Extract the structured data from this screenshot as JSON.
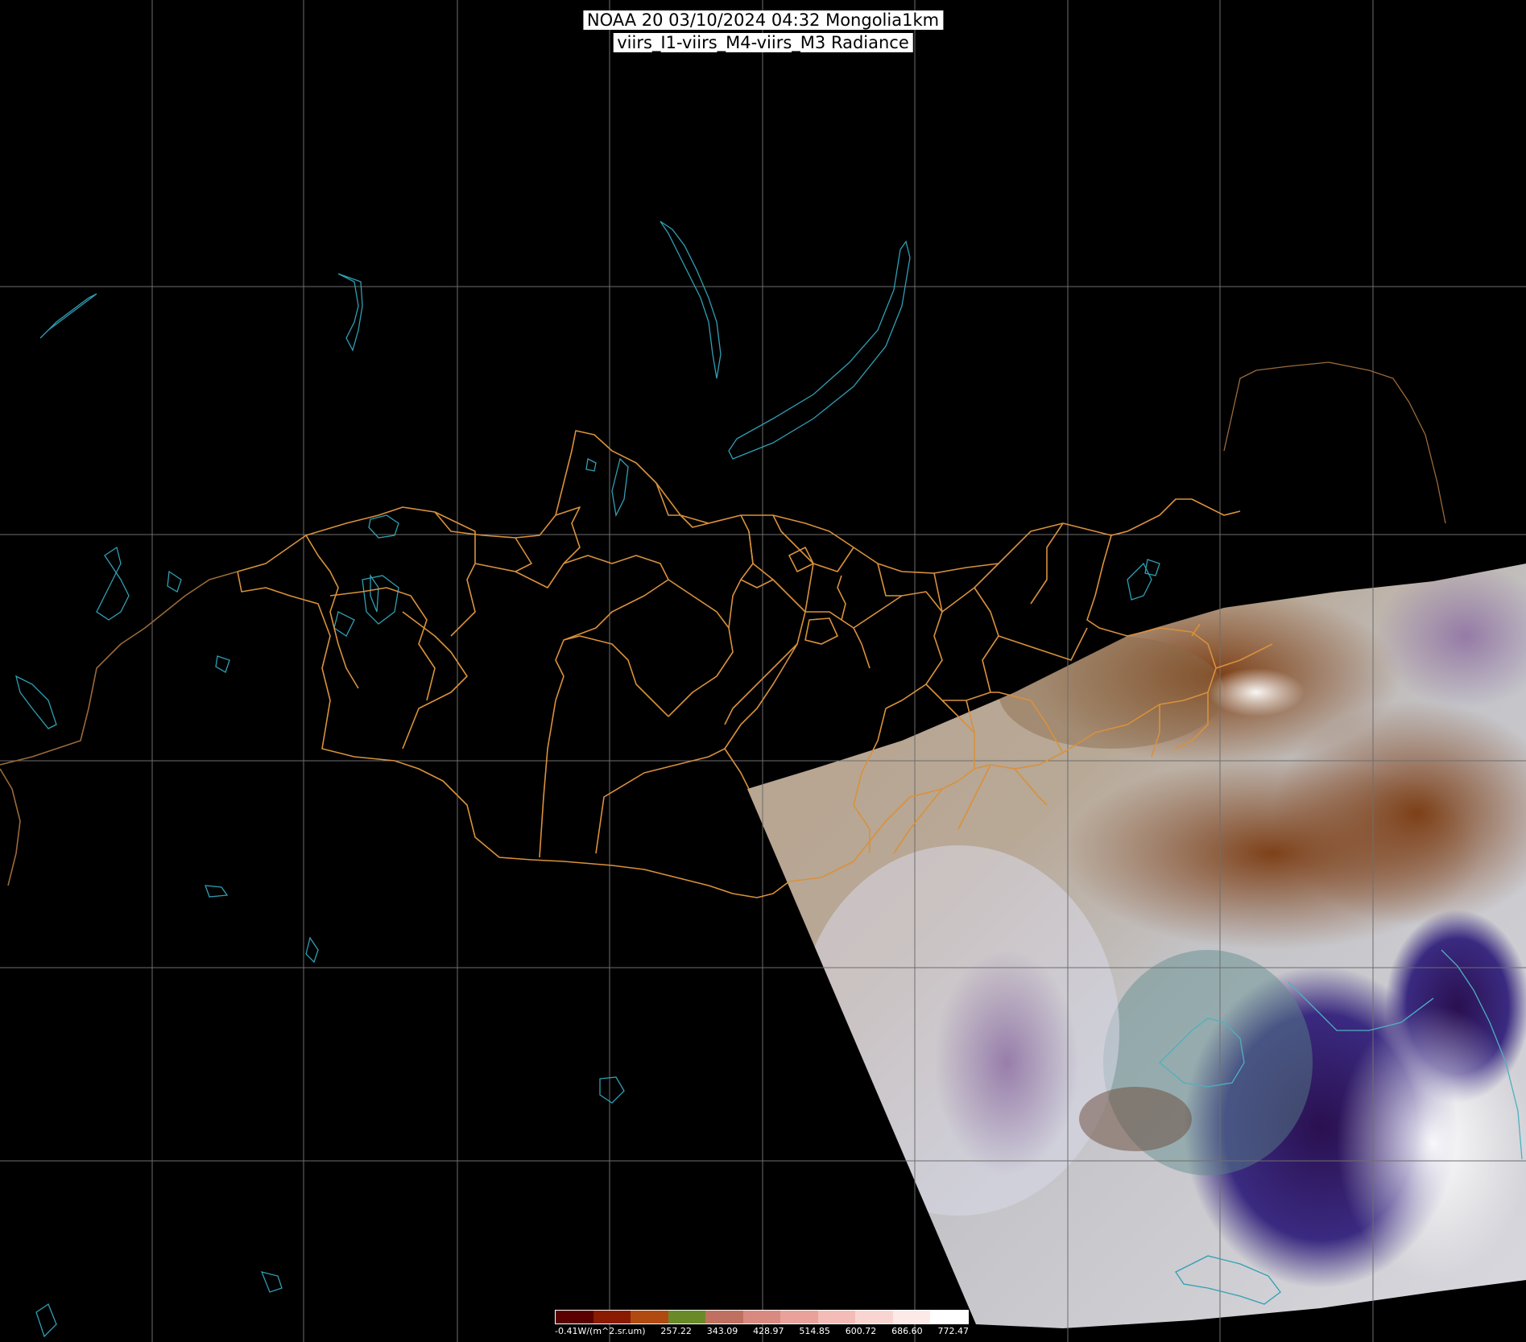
{
  "title": {
    "line1": "NOAA 20 03/10/2024 04:32 Mongolia1km",
    "line2": "viirs_I1-viirs_M4-viirs_M3 Radiance"
  },
  "map": {
    "graticule_color": "#6e6e6e",
    "border_color": "#d9913c",
    "water_color": "#2f9fb4",
    "background_color": "#000000"
  },
  "legend": {
    "unit_label": "-0.41W/(m^2.sr.um)",
    "ticks": [
      "257.22",
      "343.09",
      "428.97",
      "514.85",
      "600.72",
      "686.60",
      "772.47"
    ],
    "colors": [
      "#5a0000",
      "#8a1a00",
      "#b04a10",
      "#6a8a2a",
      "#c07060",
      "#d98a80",
      "#e9a29a",
      "#f4bcb6",
      "#f9d5d1",
      "#fde9e7",
      "#ffffff"
    ]
  }
}
